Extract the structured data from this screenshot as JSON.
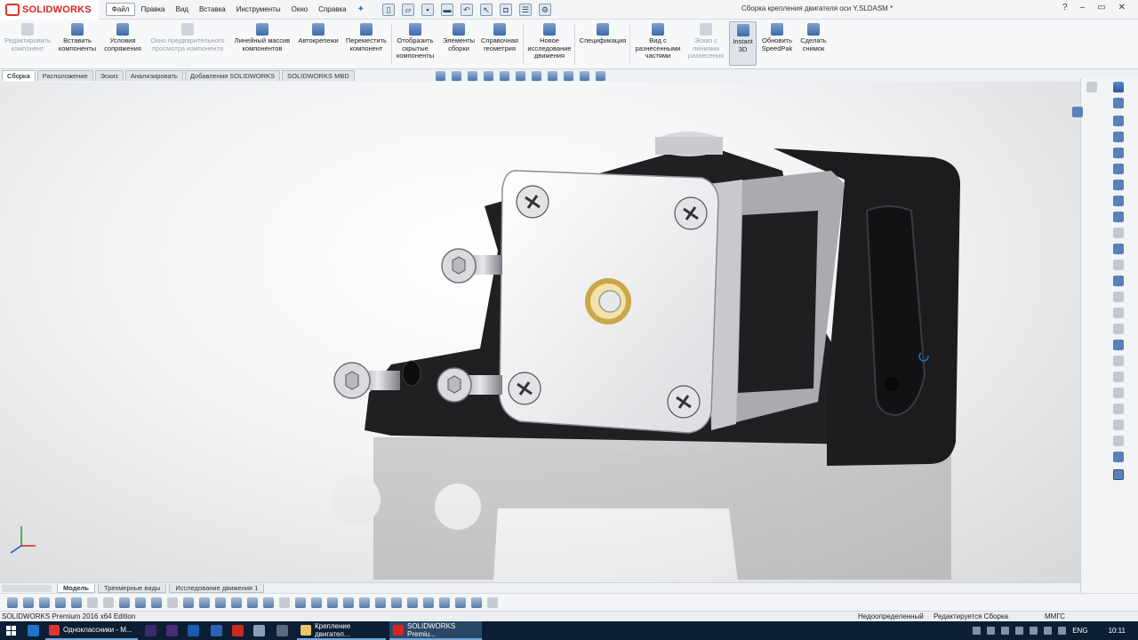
{
  "app": {
    "brand": "SOLIDWORKS",
    "window_title": "Сборка крепления двигателя оси Y.SLDASM *",
    "window_controls": [
      "?",
      "–",
      "▭",
      "✕"
    ]
  },
  "menu": [
    "Файл",
    "Правка",
    "Вид",
    "Вставка",
    "Инструменты",
    "Окно",
    "Справка"
  ],
  "ribbon": {
    "items": [
      {
        "label": "Редактировать компонент",
        "disabled": true
      },
      {
        "label": "Вставить компоненты",
        "disabled": false
      },
      {
        "label": "Условия сопряжения",
        "disabled": false
      },
      {
        "label": "Окно предварительного просмотра компонента",
        "disabled": true
      },
      {
        "label": "Линейный массив компонентов",
        "disabled": false
      },
      {
        "label": "Автокрепежи",
        "disabled": false
      },
      {
        "label": "Переместить компонент",
        "disabled": false
      },
      {
        "label": "Отобразить скрытые компоненты",
        "disabled": false
      },
      {
        "label": "Элементы сборки",
        "disabled": false
      },
      {
        "label": "Справочная геометрия",
        "disabled": false
      },
      {
        "label": "Новое исследование движения",
        "disabled": false
      },
      {
        "label": "Спецификация",
        "disabled": false
      },
      {
        "label": "Вид с разнесенными частями",
        "disabled": false
      },
      {
        "label": "Эскиз с линиями разнесения",
        "disabled": true
      },
      {
        "label": "Instant 3D",
        "disabled": false,
        "selected": true
      },
      {
        "label": "Обновить SpeedPak",
        "disabled": false
      },
      {
        "label": "Сделать снимок",
        "disabled": false
      }
    ]
  },
  "tabs": [
    "Сборка",
    "Расположение",
    "Эскиз",
    "Анализировать",
    "Добавления SOLIDWORKS",
    "SOLIDWORKS MBD"
  ],
  "bottom_tabs": [
    "Модель",
    "Трехмерные виды",
    "Исследование движения 1"
  ],
  "status": {
    "edition": "SOLIDWORKS Premium 2016 x64 Edition",
    "state": "Недоопределенный",
    "mode": "Редактируется Сборка",
    "units": "ММГС"
  },
  "taskbar": {
    "apps": [
      {
        "label": "Одноклассники - М...",
        "active": false
      },
      {
        "label": "Крепление двигател...",
        "active": false
      },
      {
        "label": "SOLIDWORKS Premiu...",
        "active": true
      }
    ],
    "lang": "ENG",
    "time": "10:11"
  },
  "colors": {
    "brand_red": "#d22222",
    "accent_blue": "#3d6aa8",
    "taskbar": "#0b1e33"
  }
}
